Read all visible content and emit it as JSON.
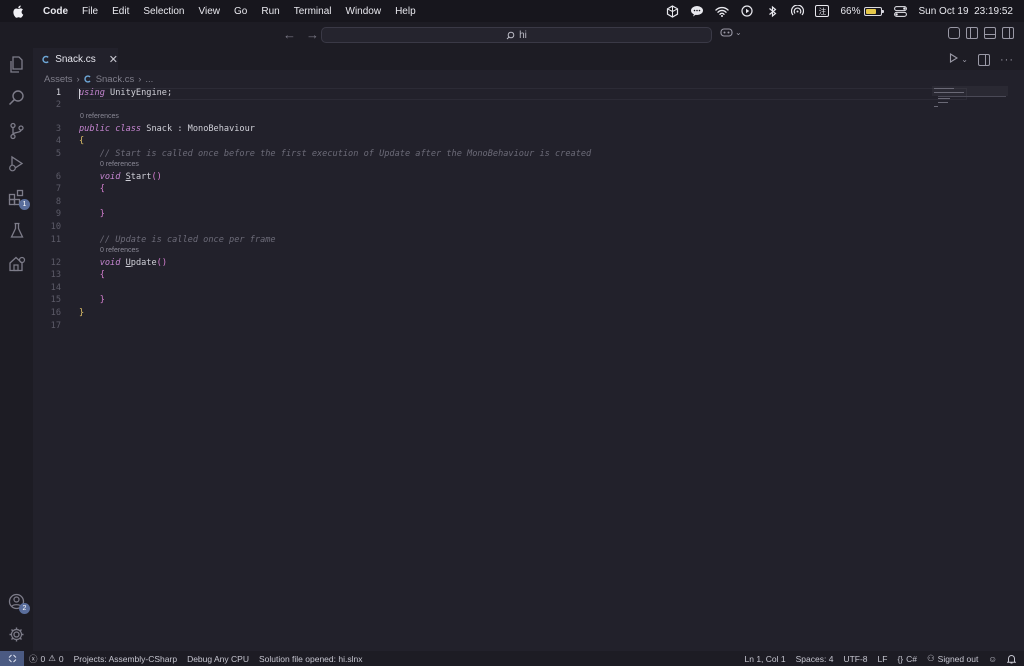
{
  "menubar": {
    "app_name": "Code",
    "items": [
      "File",
      "Edit",
      "Selection",
      "View",
      "Go",
      "Run",
      "Terminal",
      "Window",
      "Help"
    ],
    "input_method": "注",
    "battery_percent": "66%",
    "battery_level": 0.66,
    "datetime": "Sun Oct 19  23:19:52"
  },
  "titlebar": {
    "search_text": "hi"
  },
  "activity_bar": {
    "extensions_badge": "1",
    "accounts_badge": "2"
  },
  "tab": {
    "filename": "Snack.cs",
    "close_glyph": "✕"
  },
  "breadcrumb": {
    "folder": "Assets",
    "file": "Snack.cs",
    "ellipsis": "..."
  },
  "code": {
    "reference_label": "0 references",
    "lines": [
      {
        "n": "1",
        "text": "using UnityEngine;"
      },
      {
        "n": "2",
        "text": ""
      },
      {
        "n": "3",
        "text": "public class Snack : MonoBehaviour"
      },
      {
        "n": "4",
        "text": "{"
      },
      {
        "n": "5",
        "text": "    // Start is called once before the first execution of Update after the MonoBehaviour is created"
      },
      {
        "n": "6",
        "text": "    void Start()"
      },
      {
        "n": "7",
        "text": "    {"
      },
      {
        "n": "8",
        "text": ""
      },
      {
        "n": "9",
        "text": "    }"
      },
      {
        "n": "10",
        "text": ""
      },
      {
        "n": "11",
        "text": "    // Update is called once per frame"
      },
      {
        "n": "12",
        "text": "    void Update()"
      },
      {
        "n": "13",
        "text": "    {"
      },
      {
        "n": "14",
        "text": ""
      },
      {
        "n": "15",
        "text": "    }"
      },
      {
        "n": "16",
        "text": "}"
      },
      {
        "n": "17",
        "text": ""
      }
    ]
  },
  "statusbar": {
    "errors": "0",
    "warnings": "0",
    "projects": "Projects: Assembly-CSharp",
    "debug": "Debug Any CPU",
    "solution": "Solution file opened: hi.slnx",
    "position": "Ln 1, Col 1",
    "spaces": "Spaces: 4",
    "encoding": "UTF-8",
    "eol": "LF",
    "language": "C#",
    "account": "Signed out"
  },
  "colors": {
    "background": "#22212b",
    "keyword": "#d67fd1",
    "comment": "#6c6b78",
    "bracket": "#e3c46a",
    "remote_indicator": "#4b5a82"
  }
}
